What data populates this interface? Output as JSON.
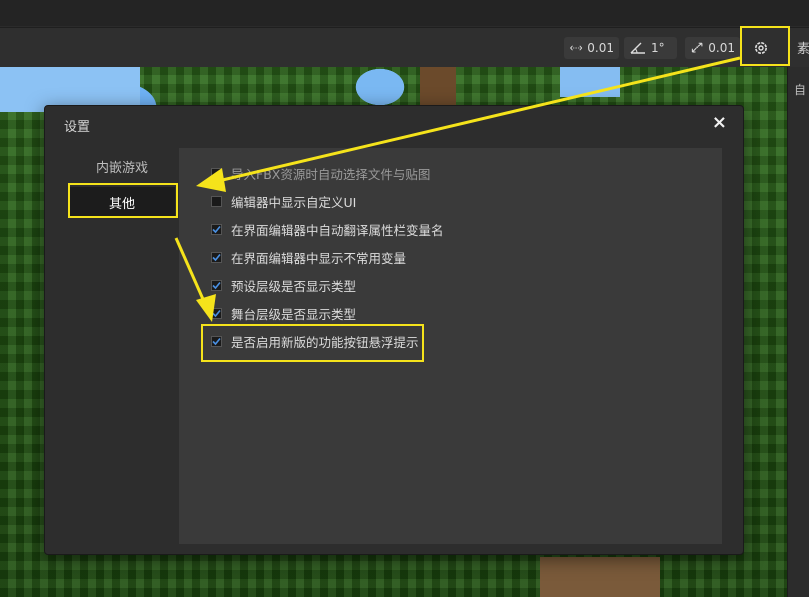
{
  "toolbar": {
    "move_snap": "0.01",
    "rotate_snap": "1°",
    "scale_snap": "0.01",
    "right_tab": "素"
  },
  "right_panel": {
    "label": "自"
  },
  "dialog": {
    "title": "设置",
    "close": "×",
    "tabs": [
      {
        "label": "内嵌游戏"
      },
      {
        "label": "其他"
      }
    ],
    "options": [
      {
        "label": "导入FBX资源时自动选择文件与贴图",
        "checked": false
      },
      {
        "label": "编辑器中显示自定义UI",
        "checked": false
      },
      {
        "label": "在界面编辑器中自动翻译属性栏变量名",
        "checked": true
      },
      {
        "label": "在界面编辑器中显示不常用变量",
        "checked": true
      },
      {
        "label": "预设层级是否显示类型",
        "checked": true
      },
      {
        "label": "舞台层级是否显示类型",
        "checked": true
      },
      {
        "label": "是否启用新版的功能按钮悬浮提示",
        "checked": true
      }
    ]
  },
  "colors": {
    "highlight": "#f5e31b",
    "check": "#4a90e2"
  }
}
